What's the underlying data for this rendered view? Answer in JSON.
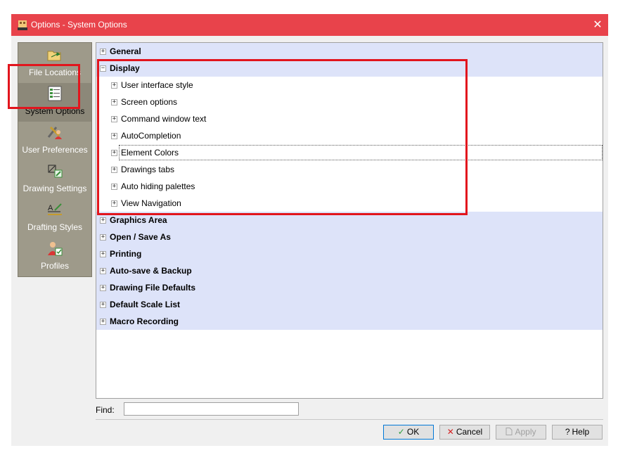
{
  "window": {
    "title": "Options - System Options",
    "close_glyph": "✕",
    "icon": "app-year-icon"
  },
  "categories": [
    {
      "label": "File Locations",
      "icon": "folder-arrow-icon"
    },
    {
      "label": "System Options",
      "icon": "system-list-icon",
      "selected": true
    },
    {
      "label": "User Preferences",
      "icon": "user-tools-icon"
    },
    {
      "label": "Drawing Settings",
      "icon": "drawing-settings-icon"
    },
    {
      "label": "Drafting Styles",
      "icon": "drafting-styles-icon"
    },
    {
      "label": "Profiles",
      "icon": "profiles-icon"
    }
  ],
  "tree": {
    "expanded_glyph": "−",
    "collapsed_glyph": "+",
    "sections": [
      {
        "label": "General",
        "expanded": false
      },
      {
        "label": "Display",
        "expanded": true,
        "children": [
          "User interface style",
          "Screen options",
          "Command window text",
          "AutoCompletion",
          "Element Colors",
          "Drawings tabs",
          "Auto hiding palettes",
          "View Navigation"
        ]
      },
      {
        "label": "Graphics Area",
        "expanded": false
      },
      {
        "label": "Open / Save As",
        "expanded": false
      },
      {
        "label": "Printing",
        "expanded": false
      },
      {
        "label": "Auto-save & Backup",
        "expanded": false
      },
      {
        "label": "Drawing File Defaults",
        "expanded": false
      },
      {
        "label": "Default Scale List",
        "expanded": false
      },
      {
        "label": "Macro Recording",
        "expanded": false
      }
    ],
    "focused_child": "Element Colors"
  },
  "find": {
    "label": "Find:",
    "value": ""
  },
  "buttons": {
    "ok": "OK",
    "cancel": "Cancel",
    "apply": "Apply",
    "help": "Help",
    "ok_glyph": "✓",
    "cancel_glyph": "✕",
    "help_glyph": "?"
  },
  "colors": {
    "title_bar": "#e8434b",
    "highlight": "#e2151d",
    "section_row": "#dde3f9",
    "category_panel": "#9e9a8a"
  }
}
